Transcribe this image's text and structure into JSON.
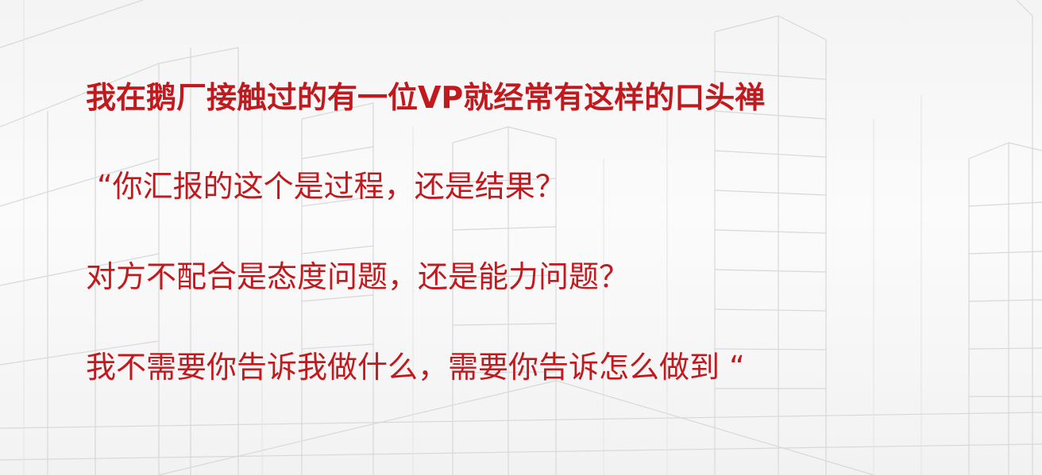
{
  "slide": {
    "headline": "我在鹅厂接触过的有一位VP就经常有这样的口头禅",
    "quote_line_1": "“你汇报的这个是过程，还是结果？",
    "quote_line_2": "对方不配合是态度问题，还是能力问题？",
    "quote_line_3": "我不需要你告诉我做什么，需要你告诉怎么做到 “"
  },
  "colors": {
    "text_red": "#c0191e",
    "background": "#f5f5f5",
    "sketch_lines": "#d6d6d6"
  }
}
